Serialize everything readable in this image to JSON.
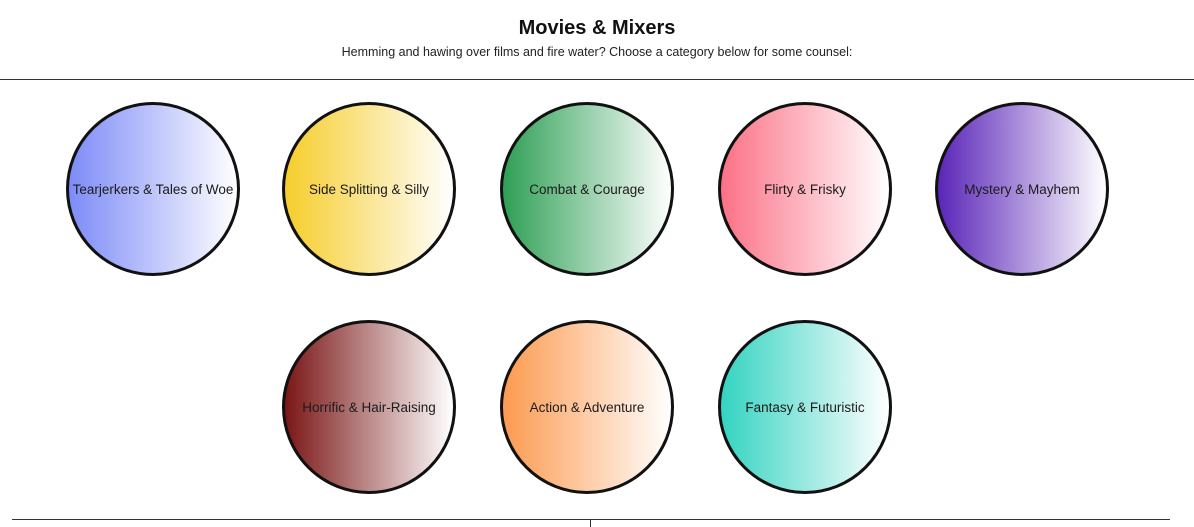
{
  "header": {
    "title": "Movies & Mixers",
    "subtitle": "Hemming and hawing over films and fire water? Choose a category below for some counsel:"
  },
  "categories": [
    {
      "label": "Tearjerkers & Tales of Woe",
      "color": "#7d8bf7"
    },
    {
      "label": "Side Splitting & Silly",
      "color": "#f6cd2b"
    },
    {
      "label": "Combat & Courage",
      "color": "#2e9f55"
    },
    {
      "label": "Flirty & Frisky",
      "color": "#fb7186"
    },
    {
      "label": "Mystery & Mayhem",
      "color": "#5a25b8"
    },
    {
      "label": "Horrific & Hair-Raising",
      "color": "#7a1616"
    },
    {
      "label": "Action & Adventure",
      "color": "#fc9a4f"
    },
    {
      "label": "Fantasy & Futuristic",
      "color": "#34d3c1"
    }
  ]
}
